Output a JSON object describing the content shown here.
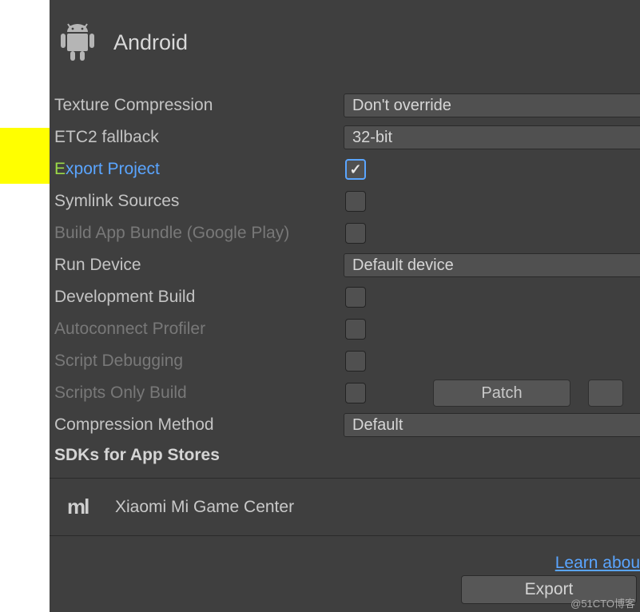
{
  "header": {
    "title": "Android"
  },
  "settings": {
    "texture_compression": {
      "label": "Texture Compression",
      "value": "Don't override"
    },
    "etc2_fallback": {
      "label": "ETC2 fallback",
      "value": "32-bit"
    },
    "export_project": {
      "label_pre": "E",
      "label_rest": "xport Project",
      "checked": true
    },
    "symlink_sources": {
      "label": "Symlink Sources",
      "checked": false
    },
    "build_app_bundle": {
      "label": "Build App Bundle (Google Play)",
      "checked": false,
      "enabled": false
    },
    "run_device": {
      "label": "Run Device",
      "value": "Default device"
    },
    "development_build": {
      "label": "Development Build",
      "checked": false
    },
    "autoconnect_profiler": {
      "label": "Autoconnect Profiler",
      "checked": false,
      "enabled": false
    },
    "script_debugging": {
      "label": "Script Debugging",
      "checked": false,
      "enabled": false
    },
    "scripts_only_build": {
      "label": "Scripts Only Build",
      "checked": false,
      "enabled": false,
      "patch_label": "Patch"
    },
    "compression_method": {
      "label": "Compression Method",
      "value": "Default"
    }
  },
  "sdks": {
    "section_title": "SDKs for App Stores",
    "xiaomi": {
      "label": "Xiaomi Mi Game Center"
    }
  },
  "footer": {
    "learn_label": "Learn abou",
    "export_label": "Export"
  },
  "watermark": "@51CTO博客"
}
